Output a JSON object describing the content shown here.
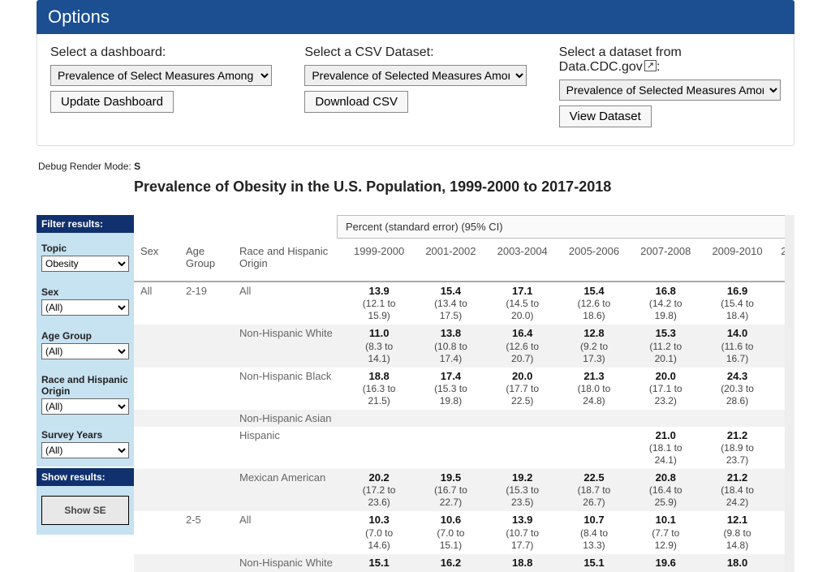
{
  "options": {
    "title": "Options",
    "cols": [
      {
        "label": "Select a dashboard:",
        "selected": "Prevalence of Select Measures Among th",
        "button": "Update Dashboard"
      },
      {
        "label": "Select a CSV Dataset:",
        "selected": "Prevalence of Selected Measures Among",
        "button": "Download CSV"
      },
      {
        "label_prefix": "Select a dataset from Data.CDC.gov",
        "ext": "↗",
        "label_suffix": ":",
        "selected": "Prevalence of Selected Measures Among",
        "button": "View Dataset"
      }
    ]
  },
  "debug": {
    "label": "Debug Render Mode: ",
    "mode": "S"
  },
  "chart_title": "Prevalence of Obesity in the U.S. Population, 1999-2000 to 2017-2018",
  "sidebar": {
    "filter_head": "Filter results:",
    "filters": [
      {
        "label": "Topic",
        "value": "Obesity"
      },
      {
        "label": "Sex",
        "value": "(All)"
      },
      {
        "label": "Age Group",
        "value": "(All)"
      },
      {
        "label": "Race and Hispanic Origin",
        "value": "(All)"
      },
      {
        "label": "Survey Years",
        "value": "(All)"
      }
    ],
    "show_head": "Show results:",
    "show_se_btn": "Show SE"
  },
  "table": {
    "meta_header": "Percent (standard error) (95% CI)",
    "headers": {
      "sex": "Sex",
      "age": "Age Group",
      "race": "Race and Hispanic Origin",
      "years": [
        "1999-2000",
        "2001-2002",
        "2003-2004",
        "2005-2006",
        "2007-2008",
        "2009-2010",
        "2"
      ]
    }
  },
  "chart_data": {
    "type": "table",
    "title": "Prevalence of Obesity in the U.S. Population, 1999-2000 to 2017-2018",
    "value_label": "Percent (standard error) (95% CI)",
    "columns": [
      "1999-2000",
      "2001-2002",
      "2003-2004",
      "2005-2006",
      "2007-2008",
      "2009-2010"
    ],
    "rows": [
      {
        "sex": "All",
        "age_group": "2-19",
        "race": "All",
        "values": [
          {
            "pct": 13.9,
            "ci": [
              12.1,
              15.9
            ]
          },
          {
            "pct": 15.4,
            "ci": [
              13.4,
              17.5
            ]
          },
          {
            "pct": 17.1,
            "ci": [
              14.5,
              20.0
            ]
          },
          {
            "pct": 15.4,
            "ci": [
              12.6,
              18.6
            ]
          },
          {
            "pct": 16.8,
            "ci": [
              14.2,
              19.8
            ]
          },
          {
            "pct": 16.9,
            "ci": [
              15.4,
              18.4
            ]
          }
        ]
      },
      {
        "sex": "All",
        "age_group": "2-19",
        "race": "Non-Hispanic White",
        "values": [
          {
            "pct": 11.0,
            "ci": [
              8.3,
              14.1
            ]
          },
          {
            "pct": 13.8,
            "ci": [
              10.8,
              17.4
            ]
          },
          {
            "pct": 16.4,
            "ci": [
              12.6,
              20.7
            ]
          },
          {
            "pct": 12.8,
            "ci": [
              9.2,
              17.3
            ]
          },
          {
            "pct": 15.3,
            "ci": [
              11.2,
              20.1
            ]
          },
          {
            "pct": 14.0,
            "ci": [
              11.6,
              16.7
            ]
          }
        ]
      },
      {
        "sex": "All",
        "age_group": "2-19",
        "race": "Non-Hispanic Black",
        "values": [
          {
            "pct": 18.8,
            "ci": [
              16.3,
              21.5
            ]
          },
          {
            "pct": 17.4,
            "ci": [
              15.3,
              19.8
            ]
          },
          {
            "pct": 20.0,
            "ci": [
              17.7,
              22.5
            ]
          },
          {
            "pct": 21.3,
            "ci": [
              18.0,
              24.8
            ]
          },
          {
            "pct": 20.0,
            "ci": [
              17.1,
              23.2
            ]
          },
          {
            "pct": 24.3,
            "ci": [
              20.3,
              28.6
            ]
          }
        ]
      },
      {
        "sex": "All",
        "age_group": "2-19",
        "race": "Non-Hispanic Asian",
        "values": [
          null,
          null,
          null,
          null,
          null,
          null
        ]
      },
      {
        "sex": "All",
        "age_group": "2-19",
        "race": "Hispanic",
        "values": [
          null,
          null,
          null,
          null,
          {
            "pct": 21.0,
            "ci": [
              18.1,
              24.1
            ]
          },
          {
            "pct": 21.2,
            "ci": [
              18.9,
              23.7
            ]
          }
        ]
      },
      {
        "sex": "All",
        "age_group": "2-19",
        "race": "Mexican American",
        "values": [
          {
            "pct": 20.2,
            "ci": [
              17.2,
              23.6
            ]
          },
          {
            "pct": 19.5,
            "ci": [
              16.7,
              22.7
            ]
          },
          {
            "pct": 19.2,
            "ci": [
              15.3,
              23.5
            ]
          },
          {
            "pct": 22.5,
            "ci": [
              18.7,
              26.7
            ]
          },
          {
            "pct": 20.8,
            "ci": [
              16.4,
              25.9
            ]
          },
          {
            "pct": 21.2,
            "ci": [
              18.4,
              24.2
            ]
          }
        ]
      },
      {
        "sex": "All",
        "age_group": "2-5",
        "race": "All",
        "values": [
          {
            "pct": 10.3,
            "ci": [
              7.0,
              14.6
            ]
          },
          {
            "pct": 10.6,
            "ci": [
              7.0,
              15.1
            ]
          },
          {
            "pct": 13.9,
            "ci": [
              10.7,
              17.7
            ]
          },
          {
            "pct": 10.7,
            "ci": [
              8.4,
              13.3
            ]
          },
          {
            "pct": 10.1,
            "ci": [
              7.7,
              12.9
            ]
          },
          {
            "pct": 12.1,
            "ci": [
              9.8,
              14.8
            ]
          }
        ]
      },
      {
        "sex": "All",
        "age_group": "2-5",
        "race": "Non-Hispanic White",
        "partial": true,
        "values": [
          {
            "pct": 15.1
          },
          {
            "pct": 16.2
          },
          {
            "pct": 18.8
          },
          {
            "pct": 15.1
          },
          {
            "pct": 19.6
          },
          {
            "pct": 18.0
          }
        ]
      }
    ]
  }
}
